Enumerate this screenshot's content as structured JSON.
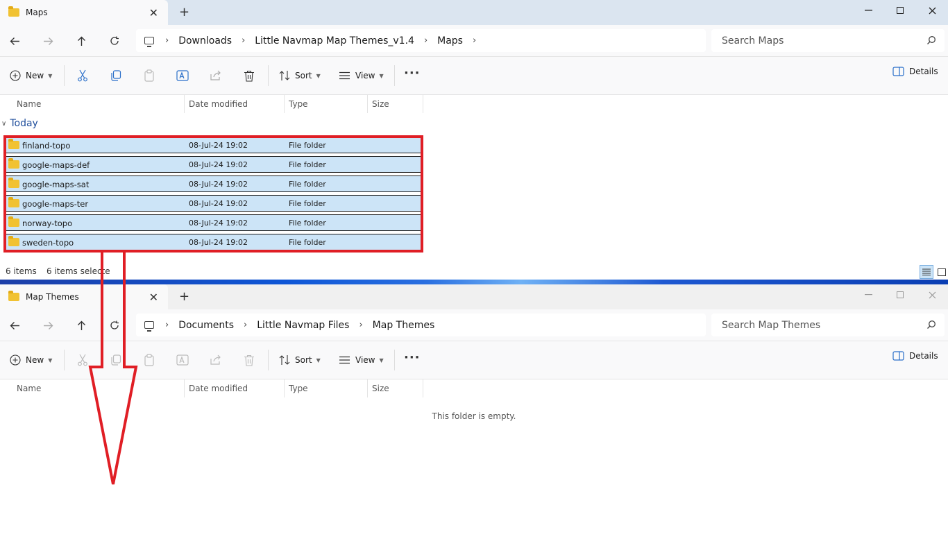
{
  "top_window": {
    "tab_title": "Maps",
    "close_tab": "✕",
    "new_tab": "+",
    "breadcrumb": [
      "Downloads",
      "Little Navmap Map Themes_v1.4",
      "Maps"
    ],
    "search_placeholder": "Search Maps",
    "toolbar": {
      "new_label": "New",
      "sort_label": "Sort",
      "view_label": "View",
      "more_label": "···",
      "details_label": "Details"
    },
    "columns": [
      "Name",
      "Date modified",
      "Type",
      "Size"
    ],
    "group_label": "Today",
    "rows": [
      {
        "name": "finland-topo",
        "date": "08-Jul-24 19:02",
        "type": "File folder"
      },
      {
        "name": "google-maps-def",
        "date": "08-Jul-24 19:02",
        "type": "File folder"
      },
      {
        "name": "google-maps-sat",
        "date": "08-Jul-24 19:02",
        "type": "File folder"
      },
      {
        "name": "google-maps-ter",
        "date": "08-Jul-24 19:02",
        "type": "File folder"
      },
      {
        "name": "norway-topo",
        "date": "08-Jul-24 19:02",
        "type": "File folder"
      },
      {
        "name": "sweden-topo",
        "date": "08-Jul-24 19:02",
        "type": "File folder"
      }
    ],
    "status": {
      "item_count": "6 items",
      "selected_count": "6 items selecte"
    }
  },
  "bottom_window": {
    "tab_title": "Map Themes",
    "close_tab": "✕",
    "new_tab": "+",
    "breadcrumb": [
      "Documents",
      "Little Navmap Files",
      "Map Themes"
    ],
    "search_placeholder": "Search Map Themes",
    "toolbar": {
      "new_label": "New",
      "sort_label": "Sort",
      "view_label": "View",
      "more_label": "···",
      "details_label": "Details"
    },
    "columns": [
      "Name",
      "Date modified",
      "Type",
      "Size"
    ],
    "empty_message": "This folder is empty."
  },
  "colors": {
    "selection_fill": "#cce4f7",
    "annotation_red": "#e01e25",
    "group_blue": "#1f4e9c"
  }
}
